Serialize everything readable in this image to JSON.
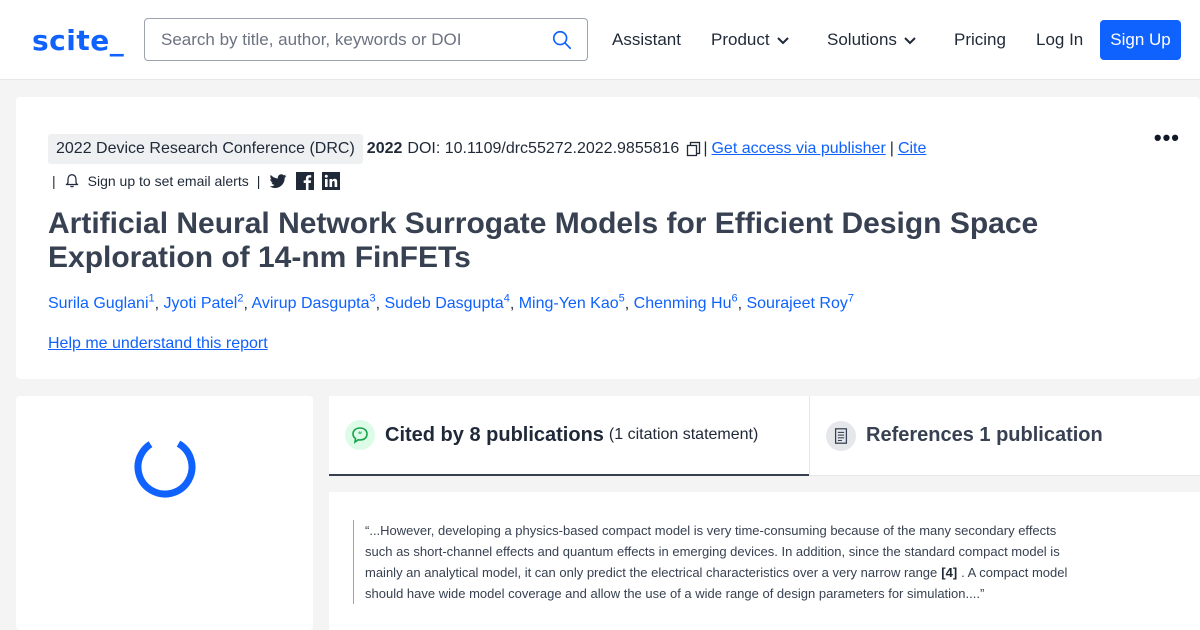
{
  "header": {
    "logo": "scite_",
    "search_placeholder": "Search by title, author, keywords or DOI",
    "nav": {
      "assistant": "Assistant",
      "product": "Product",
      "solutions": "Solutions",
      "pricing": "Pricing",
      "login": "Log In",
      "signup": "Sign Up"
    }
  },
  "paper": {
    "venue": "2022 Device Research Conference (DRC)",
    "year": "2022",
    "doi": "DOI: 10.1109/drc55272.2022.9855816",
    "sep": "|",
    "access_link": "Get access via publisher",
    "cite_link": "Cite",
    "more": "•••",
    "alerts_text": "Sign up to set email alerts",
    "title": "Artificial Neural Network Surrogate Models for Efficient Design Space Exploration of 14-nm FinFETs",
    "authors": [
      {
        "name": "Surila Guglani",
        "sup": "1"
      },
      {
        "name": "Jyoti Patel",
        "sup": "2"
      },
      {
        "name": "Avirup Dasgupta",
        "sup": "3"
      },
      {
        "name": "Sudeb Dasgupta",
        "sup": "4"
      },
      {
        "name": "Ming-Yen Kao",
        "sup": "5"
      },
      {
        "name": "Chenming Hu",
        "sup": "6"
      },
      {
        "name": "Sourajeet Roy",
        "sup": "7"
      }
    ],
    "help_link": "Help me understand this report"
  },
  "tabs": {
    "cited_label": "Cited by 8 publications",
    "cited_sub": "(1 citation statement)",
    "refs_label": "References 1 publication"
  },
  "statement": {
    "text_before": "“...However, developing a physics-based compact model is very time-consuming because of the many secondary effects such as short-channel effects and quantum effects in emerging devices. In addition, since the standard compact model is mainly an analytical model, it can only predict the electrical characteristics over a very narrow range",
    "ref": "[4]",
    "text_after": ". A compact model should have wide model coverage and allow the use of a wide range of design parameters for simulation....”"
  },
  "colors": {
    "brand": "#0f62fe",
    "cited_icon_bg": "#dcfce7",
    "cited_icon": "#16a34a"
  }
}
